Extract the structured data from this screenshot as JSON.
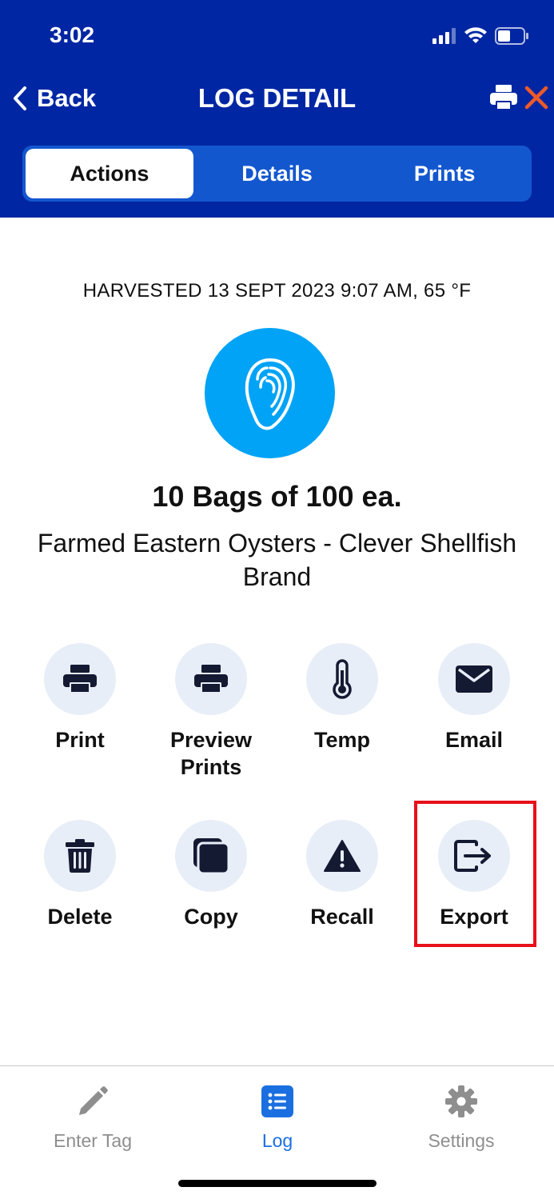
{
  "status_bar": {
    "time": "3:02"
  },
  "nav": {
    "back_label": "Back",
    "title": "LOG DETAIL"
  },
  "segments": [
    {
      "label": "Actions",
      "active": true
    },
    {
      "label": "Details",
      "active": false
    },
    {
      "label": "Prints",
      "active": false
    }
  ],
  "log": {
    "harvest_info": "HARVESTED 13 SEPT 2023 9:07 AM, 65 °F",
    "quantity": "10 Bags of 100 ea.",
    "product": "Farmed Eastern Oysters - Clever Shellfish Brand"
  },
  "actions": [
    {
      "label": "Print",
      "icon": "printer-icon"
    },
    {
      "label": "Preview Prints",
      "icon": "printer-icon"
    },
    {
      "label": "Temp",
      "icon": "thermometer-icon"
    },
    {
      "label": "Email",
      "icon": "envelope-icon"
    },
    {
      "label": "Delete",
      "icon": "trash-icon"
    },
    {
      "label": "Copy",
      "icon": "copy-icon"
    },
    {
      "label": "Recall",
      "icon": "warning-icon"
    },
    {
      "label": "Export",
      "icon": "export-icon"
    }
  ],
  "tabbar": [
    {
      "label": "Enter Tag",
      "icon": "pencil-icon",
      "active": false
    },
    {
      "label": "Log",
      "icon": "list-icon",
      "active": true
    },
    {
      "label": "Settings",
      "icon": "gear-icon",
      "active": false
    }
  ],
  "colors": {
    "header": "#0026a3",
    "segment_bg": "#1357cf",
    "product_circle": "#00a3f6",
    "close_icon": "#f05a28",
    "highlight": "#e8101a",
    "tab_active": "#1a6fe0"
  }
}
